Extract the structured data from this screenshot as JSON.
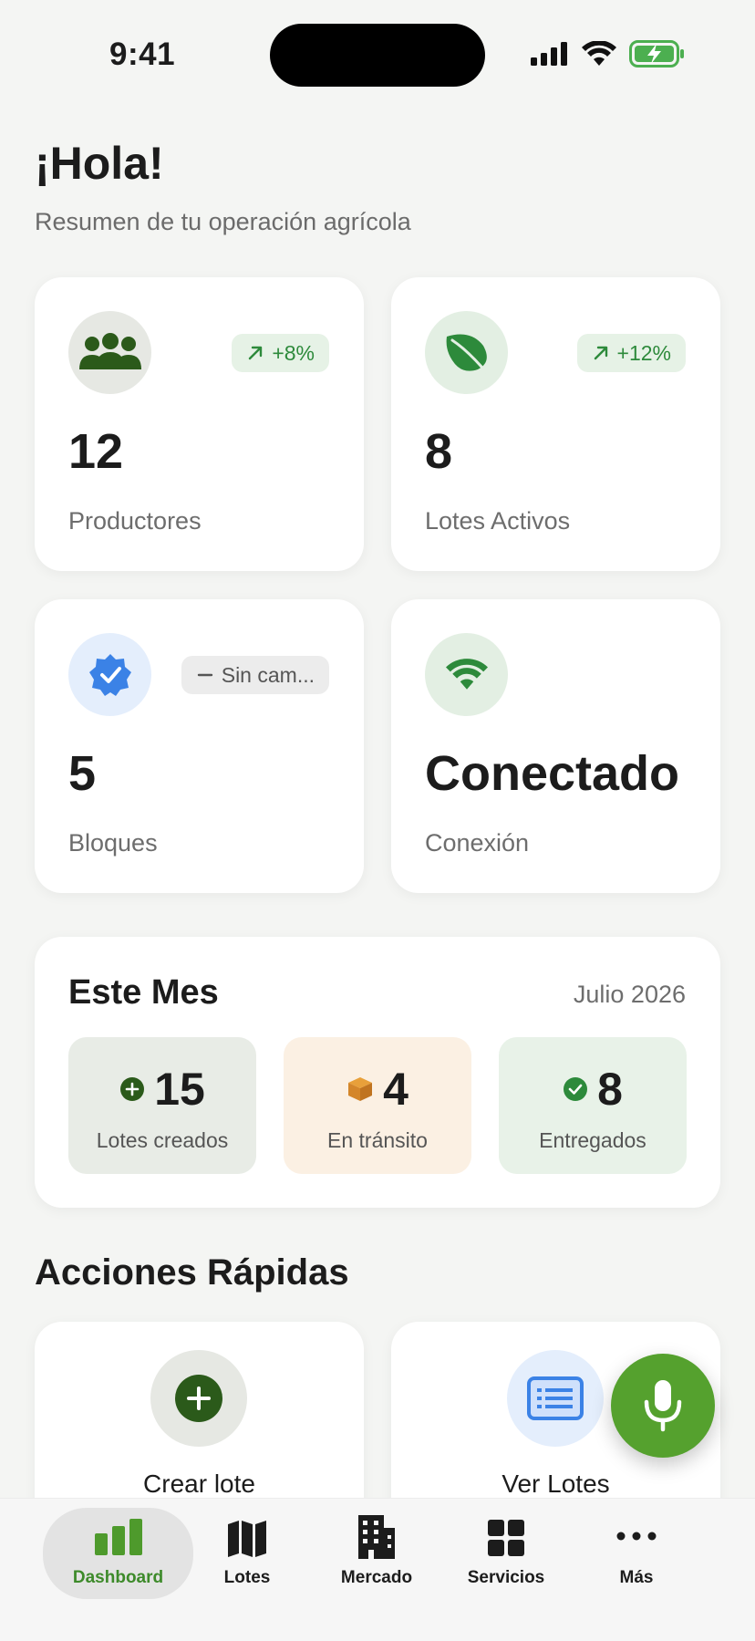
{
  "status_bar": {
    "time": "9:41"
  },
  "header": {
    "greeting": "¡Hola!",
    "subtitle": "Resumen de tu operación agrícola"
  },
  "stats": [
    {
      "value": "12",
      "label": "Productores",
      "badge": "+8%",
      "trend": "up",
      "icon": "people-group-icon"
    },
    {
      "value": "8",
      "label": "Lotes Activos",
      "badge": "+12%",
      "trend": "up",
      "icon": "leaf-icon"
    },
    {
      "value": "5",
      "label": "Bloques",
      "badge": "Sin cam...",
      "trend": "flat",
      "icon": "verified-badge-icon"
    },
    {
      "value": "Conectado",
      "label": "Conexión",
      "icon": "wifi-icon"
    }
  ],
  "month": {
    "title": "Este Mes",
    "date": "Julio 2026",
    "items": [
      {
        "value": "15",
        "label": "Lotes creados",
        "icon": "plus-circle-icon",
        "color": "#e8ece6"
      },
      {
        "value": "4",
        "label": "En tránsito",
        "icon": "box-icon",
        "color": "#fbf0e3"
      },
      {
        "value": "8",
        "label": "Entregados",
        "icon": "check-circle-icon",
        "color": "#e8f2e8"
      }
    ]
  },
  "quick_actions": {
    "title": "Acciones Rápidas",
    "items": [
      {
        "label": "Crear lote",
        "icon": "plus-circle-icon"
      },
      {
        "label": "Ver Lotes",
        "icon": "list-icon"
      }
    ]
  },
  "fab": {
    "icon": "microphone-icon"
  },
  "tabbar": [
    {
      "label": "Dashboard",
      "icon": "bar-chart-icon",
      "active": true
    },
    {
      "label": "Lotes",
      "icon": "map-icon"
    },
    {
      "label": "Mercado",
      "icon": "building-icon"
    },
    {
      "label": "Servicios",
      "icon": "grid-icon"
    },
    {
      "label": "Más",
      "icon": "more-icon"
    }
  ],
  "colors": {
    "accent": "#55a12e",
    "dark_green": "#2b5a1a",
    "trend_green": "#2d8a3b"
  }
}
